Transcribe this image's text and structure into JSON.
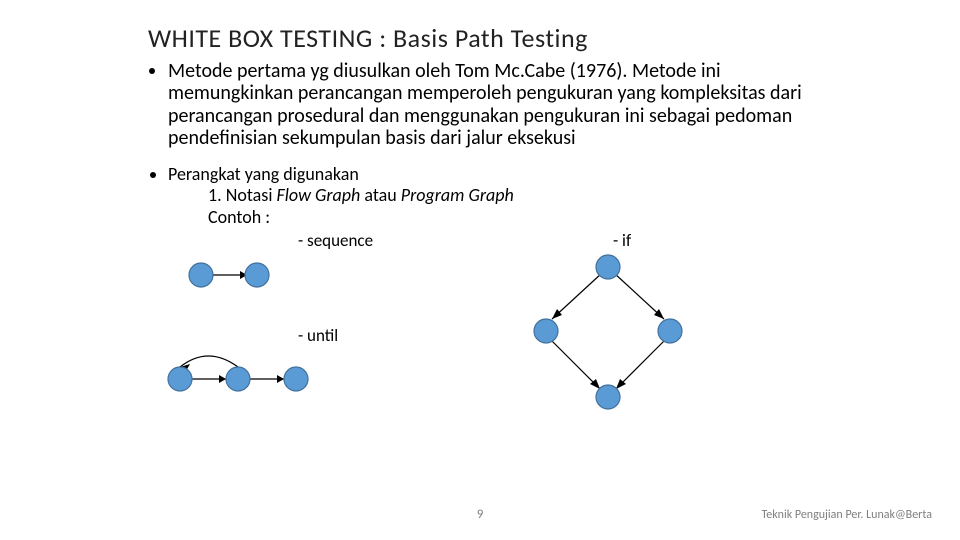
{
  "title": "WHITE BOX TESTING : Basis Path Testing",
  "bullets": {
    "first": "Metode pertama yg diusulkan oleh Tom Mc.Cabe (1976). Metode ini memungkinkan perancangan memperoleh pengukuran yang kompleksitas dari perancangan prosedural dan menggunakan pengukuran ini sebagai pedoman pendefinisian sekumpulan basis dari jalur eksekusi",
    "second": "Perangkat yang digunakan"
  },
  "notasi": {
    "line_lead": "1. Notasi ",
    "em1": "Flow Graph",
    "mid": " atau ",
    "em2": "Program Graph",
    "contoh": "Contoh :"
  },
  "graph_labels": {
    "sequence": "- sequence",
    "if": "- if",
    "until": "- until"
  },
  "chart_data": [
    {
      "type": "diagram",
      "name": "sequence",
      "nodes": [
        "A",
        "B"
      ],
      "edges": [
        [
          "A",
          "B"
        ]
      ]
    },
    {
      "type": "diagram",
      "name": "if",
      "nodes": [
        "A",
        "B",
        "C",
        "D"
      ],
      "edges": [
        [
          "A",
          "B"
        ],
        [
          "A",
          "C"
        ],
        [
          "B",
          "D"
        ],
        [
          "C",
          "D"
        ]
      ]
    },
    {
      "type": "diagram",
      "name": "until",
      "nodes": [
        "A",
        "B",
        "C"
      ],
      "edges": [
        [
          "A",
          "B"
        ],
        [
          "B",
          "C"
        ],
        [
          "B",
          "A"
        ]
      ]
    }
  ],
  "footer": {
    "page": "9",
    "credit": "Teknik Pengujian Per. Lunak@Berta"
  }
}
